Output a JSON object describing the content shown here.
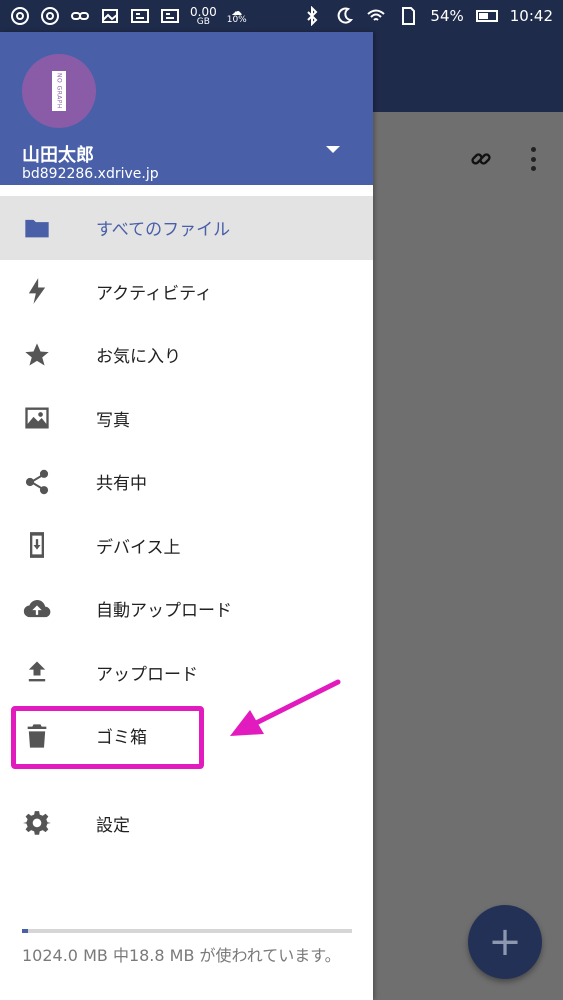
{
  "status_bar": {
    "data_usage_value": "0.00",
    "data_usage_unit": "GB",
    "data_percent": "10%",
    "battery_percent": "54%",
    "time": "10:42",
    "icons": [
      "chrome-icon",
      "chrome-icon",
      "link-icon",
      "image-icon",
      "ge-icon",
      "ge-icon",
      "bluetooth-icon",
      "moon-icon",
      "wifi-icon",
      "sd-card-icon",
      "battery-icon"
    ]
  },
  "drawer": {
    "user_name": "山田太郎",
    "user_email": "bd892286.xdrive.jp",
    "avatar_text": "NO GRAPH",
    "nav_items": [
      {
        "label": "すべてのファイル",
        "icon": "folder-icon",
        "active": true
      },
      {
        "label": "アクティビティ",
        "icon": "lightning-icon",
        "active": false
      },
      {
        "label": "お気に入り",
        "icon": "star-icon",
        "active": false
      },
      {
        "label": "写真",
        "icon": "image-icon",
        "active": false
      },
      {
        "label": "共有中",
        "icon": "share-icon",
        "active": false
      },
      {
        "label": "デバイス上",
        "icon": "device-download-icon",
        "active": false
      },
      {
        "label": "自動アップロード",
        "icon": "cloud-upload-icon",
        "active": false
      },
      {
        "label": "アップロード",
        "icon": "upload-icon",
        "active": false
      },
      {
        "label": "ゴミ箱",
        "icon": "trash-icon",
        "active": false
      }
    ],
    "settings_label": "設定",
    "storage_text": "1024.0 MB 中18.8 MB が使われています。",
    "storage_used_fraction": 0.018
  },
  "app": {
    "fab_symbol": "+"
  },
  "colors": {
    "drawer_header": "#4960a8",
    "accent": "#4960a8",
    "annotation": "#e21bbf",
    "toolbar": "#1f2b4a"
  }
}
